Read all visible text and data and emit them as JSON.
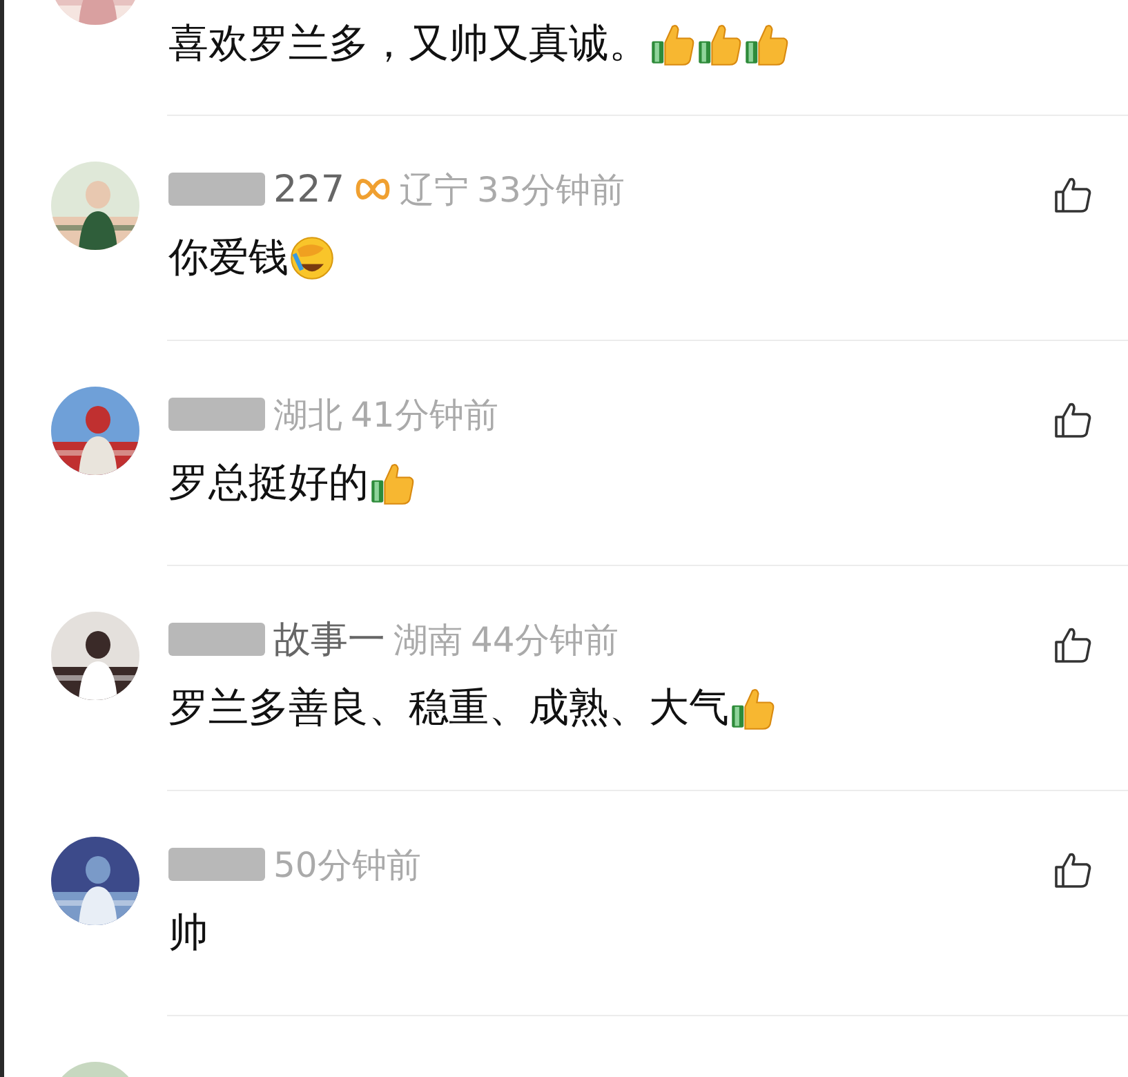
{
  "comments": [
    {
      "kind": "partial",
      "text": "喜欢罗兰多，又帅又真诚。",
      "emojis": [
        {
          "kind": "thumbs-up"
        },
        {
          "kind": "thumbs-up"
        },
        {
          "kind": "thumbs-up"
        }
      ]
    },
    {
      "kind": "full",
      "name": "227",
      "badge": true,
      "location": "辽宁",
      "time": "33分钟前",
      "text": "你爱钱",
      "emojis": [
        {
          "kind": "facepalm-laugh"
        }
      ]
    },
    {
      "kind": "full",
      "location": "湖北",
      "time": "41分钟前",
      "text": "罗总挺好的",
      "emojis": [
        {
          "kind": "thumbs-up"
        }
      ]
    },
    {
      "kind": "full",
      "name": "故事一",
      "location": "湖南",
      "time": "44分钟前",
      "text": "罗兰多善良、稳重、成熟、大气",
      "emojis": [
        {
          "kind": "thumbs-up"
        }
      ]
    },
    {
      "kind": "full",
      "time": "50分钟前",
      "text": "帅"
    },
    {
      "kind": "avatar-only"
    }
  ]
}
